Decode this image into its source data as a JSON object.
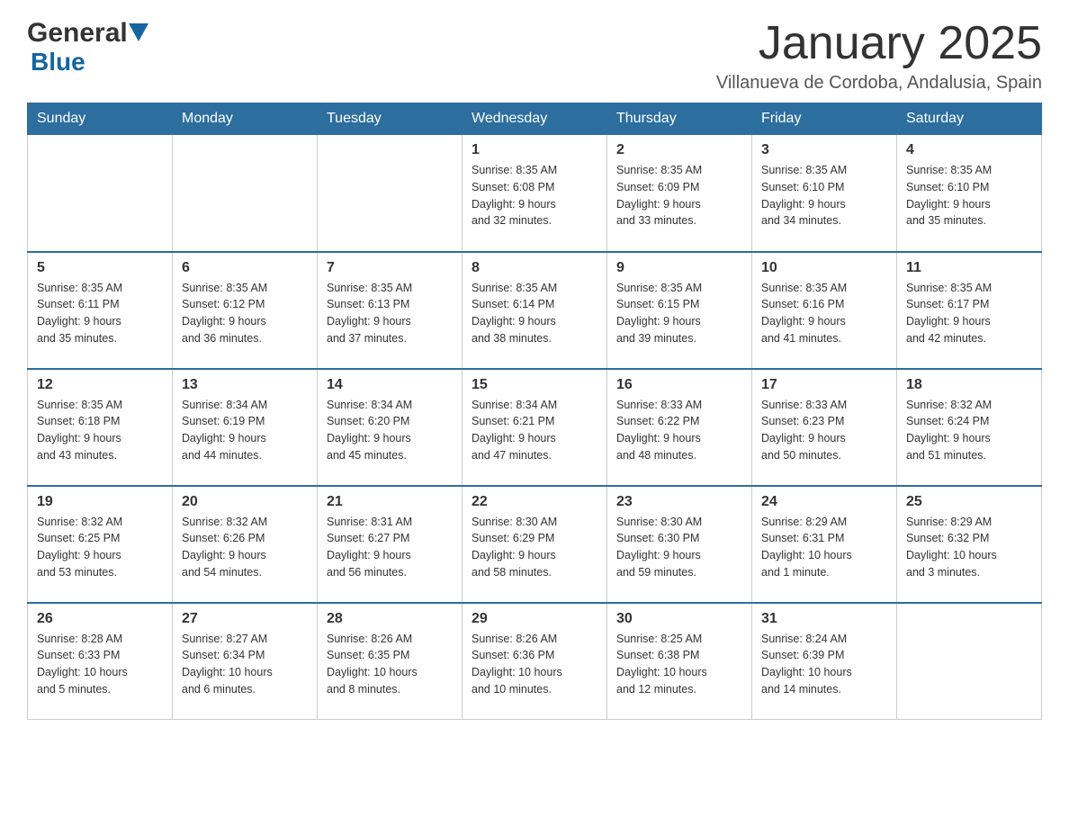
{
  "header": {
    "logo_general": "General",
    "logo_blue": "Blue",
    "month_title": "January 2025",
    "location": "Villanueva de Cordoba, Andalusia, Spain"
  },
  "days_of_week": [
    "Sunday",
    "Monday",
    "Tuesday",
    "Wednesday",
    "Thursday",
    "Friday",
    "Saturday"
  ],
  "weeks": [
    [
      {
        "day": "",
        "info": ""
      },
      {
        "day": "",
        "info": ""
      },
      {
        "day": "",
        "info": ""
      },
      {
        "day": "1",
        "info": "Sunrise: 8:35 AM\nSunset: 6:08 PM\nDaylight: 9 hours\nand 32 minutes."
      },
      {
        "day": "2",
        "info": "Sunrise: 8:35 AM\nSunset: 6:09 PM\nDaylight: 9 hours\nand 33 minutes."
      },
      {
        "day": "3",
        "info": "Sunrise: 8:35 AM\nSunset: 6:10 PM\nDaylight: 9 hours\nand 34 minutes."
      },
      {
        "day": "4",
        "info": "Sunrise: 8:35 AM\nSunset: 6:10 PM\nDaylight: 9 hours\nand 35 minutes."
      }
    ],
    [
      {
        "day": "5",
        "info": "Sunrise: 8:35 AM\nSunset: 6:11 PM\nDaylight: 9 hours\nand 35 minutes."
      },
      {
        "day": "6",
        "info": "Sunrise: 8:35 AM\nSunset: 6:12 PM\nDaylight: 9 hours\nand 36 minutes."
      },
      {
        "day": "7",
        "info": "Sunrise: 8:35 AM\nSunset: 6:13 PM\nDaylight: 9 hours\nand 37 minutes."
      },
      {
        "day": "8",
        "info": "Sunrise: 8:35 AM\nSunset: 6:14 PM\nDaylight: 9 hours\nand 38 minutes."
      },
      {
        "day": "9",
        "info": "Sunrise: 8:35 AM\nSunset: 6:15 PM\nDaylight: 9 hours\nand 39 minutes."
      },
      {
        "day": "10",
        "info": "Sunrise: 8:35 AM\nSunset: 6:16 PM\nDaylight: 9 hours\nand 41 minutes."
      },
      {
        "day": "11",
        "info": "Sunrise: 8:35 AM\nSunset: 6:17 PM\nDaylight: 9 hours\nand 42 minutes."
      }
    ],
    [
      {
        "day": "12",
        "info": "Sunrise: 8:35 AM\nSunset: 6:18 PM\nDaylight: 9 hours\nand 43 minutes."
      },
      {
        "day": "13",
        "info": "Sunrise: 8:34 AM\nSunset: 6:19 PM\nDaylight: 9 hours\nand 44 minutes."
      },
      {
        "day": "14",
        "info": "Sunrise: 8:34 AM\nSunset: 6:20 PM\nDaylight: 9 hours\nand 45 minutes."
      },
      {
        "day": "15",
        "info": "Sunrise: 8:34 AM\nSunset: 6:21 PM\nDaylight: 9 hours\nand 47 minutes."
      },
      {
        "day": "16",
        "info": "Sunrise: 8:33 AM\nSunset: 6:22 PM\nDaylight: 9 hours\nand 48 minutes."
      },
      {
        "day": "17",
        "info": "Sunrise: 8:33 AM\nSunset: 6:23 PM\nDaylight: 9 hours\nand 50 minutes."
      },
      {
        "day": "18",
        "info": "Sunrise: 8:32 AM\nSunset: 6:24 PM\nDaylight: 9 hours\nand 51 minutes."
      }
    ],
    [
      {
        "day": "19",
        "info": "Sunrise: 8:32 AM\nSunset: 6:25 PM\nDaylight: 9 hours\nand 53 minutes."
      },
      {
        "day": "20",
        "info": "Sunrise: 8:32 AM\nSunset: 6:26 PM\nDaylight: 9 hours\nand 54 minutes."
      },
      {
        "day": "21",
        "info": "Sunrise: 8:31 AM\nSunset: 6:27 PM\nDaylight: 9 hours\nand 56 minutes."
      },
      {
        "day": "22",
        "info": "Sunrise: 8:30 AM\nSunset: 6:29 PM\nDaylight: 9 hours\nand 58 minutes."
      },
      {
        "day": "23",
        "info": "Sunrise: 8:30 AM\nSunset: 6:30 PM\nDaylight: 9 hours\nand 59 minutes."
      },
      {
        "day": "24",
        "info": "Sunrise: 8:29 AM\nSunset: 6:31 PM\nDaylight: 10 hours\nand 1 minute."
      },
      {
        "day": "25",
        "info": "Sunrise: 8:29 AM\nSunset: 6:32 PM\nDaylight: 10 hours\nand 3 minutes."
      }
    ],
    [
      {
        "day": "26",
        "info": "Sunrise: 8:28 AM\nSunset: 6:33 PM\nDaylight: 10 hours\nand 5 minutes."
      },
      {
        "day": "27",
        "info": "Sunrise: 8:27 AM\nSunset: 6:34 PM\nDaylight: 10 hours\nand 6 minutes."
      },
      {
        "day": "28",
        "info": "Sunrise: 8:26 AM\nSunset: 6:35 PM\nDaylight: 10 hours\nand 8 minutes."
      },
      {
        "day": "29",
        "info": "Sunrise: 8:26 AM\nSunset: 6:36 PM\nDaylight: 10 hours\nand 10 minutes."
      },
      {
        "day": "30",
        "info": "Sunrise: 8:25 AM\nSunset: 6:38 PM\nDaylight: 10 hours\nand 12 minutes."
      },
      {
        "day": "31",
        "info": "Sunrise: 8:24 AM\nSunset: 6:39 PM\nDaylight: 10 hours\nand 14 minutes."
      },
      {
        "day": "",
        "info": ""
      }
    ]
  ]
}
